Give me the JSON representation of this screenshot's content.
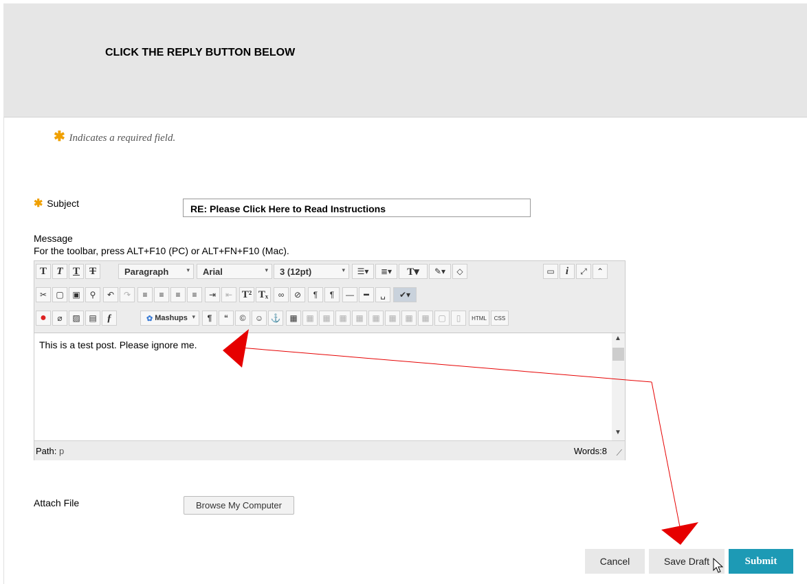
{
  "banner": {
    "title": "CLICK THE REPLY BUTTON BELOW"
  },
  "required_note": {
    "star": "✱",
    "text": "Indicates a required field."
  },
  "subject": {
    "label": "Subject",
    "value": "RE: Please Click Here to Read Instructions"
  },
  "message": {
    "label": "Message",
    "toolbar_hint": "For the toolbar, press ALT+F10 (PC) or ALT+FN+F10 (Mac)."
  },
  "editor": {
    "format_select": "Paragraph",
    "font_select": "Arial",
    "size_select": "3 (12pt)",
    "mashups_label": "Mashups",
    "html_label": "HTML",
    "css_label": "CSS",
    "content": "This is a test post. Please ignore me.",
    "path_label": "Path:",
    "path_value": "p",
    "word_count": "Words:8"
  },
  "attach": {
    "label": "Attach File",
    "browse_label": "Browse My Computer"
  },
  "actions": {
    "cancel": "Cancel",
    "save_draft": "Save Draft",
    "submit": "Submit"
  },
  "colors": {
    "submit": "#1d9ab5",
    "required_star": "#f0a000",
    "annotation": "#e60000"
  }
}
